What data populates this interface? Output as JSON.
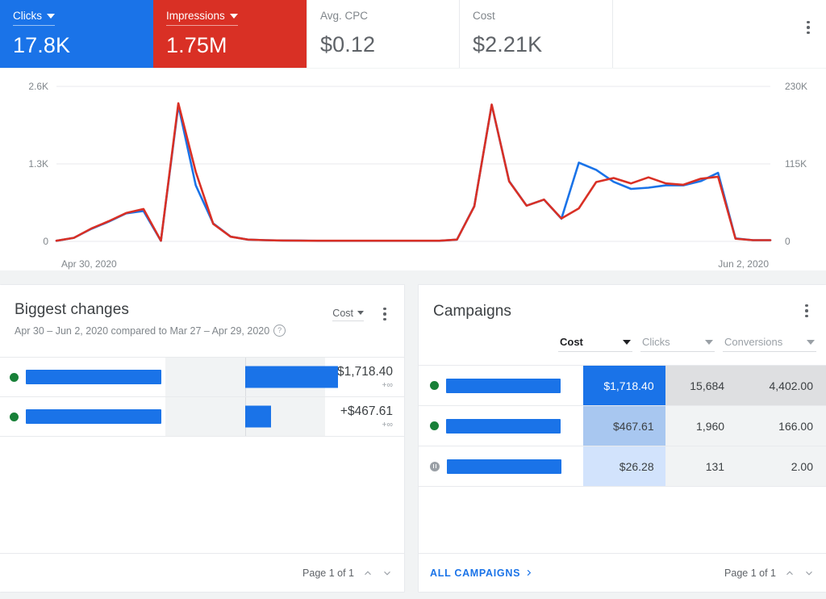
{
  "scorecards": [
    {
      "label": "Clicks",
      "value": "17.8K",
      "style": "blue",
      "icon": "chevron-down-icon"
    },
    {
      "label": "Impressions",
      "value": "1.75M",
      "style": "red",
      "icon": "chevron-down-icon"
    },
    {
      "label": "Avg. CPC",
      "value": "$0.12",
      "style": "plain",
      "icon": ""
    },
    {
      "label": "Cost",
      "value": "$2.21K",
      "style": "plain",
      "icon": ""
    }
  ],
  "strip_menu_icon": "kebab-menu-icon",
  "chart_data": {
    "type": "line",
    "title": "",
    "xlabel": "",
    "ylabel": "Clicks",
    "y2label": "Impressions",
    "grid": true,
    "legend": "none",
    "left_axis": {
      "ticks": [
        "0",
        "1.3K",
        "2.6K"
      ],
      "min": 0,
      "max": 2600
    },
    "right_axis": {
      "ticks": [
        "0",
        "115K",
        "230K"
      ],
      "min": 0,
      "max": 230000
    },
    "x_ticks": [
      "Apr 30, 2020",
      "Jun 2, 2020"
    ],
    "x_start": "Apr 30, 2020",
    "x_end": "Jun 2, 2020",
    "series": [
      {
        "name": "Clicks",
        "color": "#1a73e8",
        "axis": "left",
        "values": [
          10,
          60,
          210,
          330,
          470,
          510,
          10,
          2280,
          940,
          300,
          80,
          30,
          20,
          15,
          12,
          10,
          10,
          10,
          10,
          10,
          10,
          10,
          10,
          30,
          590,
          2290,
          1010,
          600,
          700,
          380,
          1320,
          1200,
          1000,
          880,
          900,
          940,
          940,
          1010,
          1150,
          50,
          20,
          20
        ]
      },
      {
        "name": "Impressions",
        "color": "#d93025",
        "axis": "right",
        "values": [
          900,
          5300,
          19000,
          30000,
          42000,
          48000,
          900,
          205000,
          103000,
          26000,
          7000,
          2600,
          1800,
          1300,
          1100,
          900,
          900,
          900,
          900,
          900,
          900,
          900,
          900,
          2600,
          52000,
          203000,
          89000,
          53000,
          62000,
          34000,
          49000,
          88000,
          94000,
          86000,
          95000,
          86000,
          84000,
          93000,
          96000,
          4000,
          1800,
          1800
        ]
      }
    ]
  },
  "biggest_changes": {
    "title": "Biggest changes",
    "subtitle": "Apr 30 – Jun 2, 2020 compared to Mar 27 – Apr 29, 2020",
    "help_icon": "help-circle-icon",
    "metric_selector": "Cost",
    "metric_caret_icon": "chevron-down-icon",
    "menu_icon": "kebab-menu-icon",
    "rows": [
      {
        "status": "enabled",
        "status_icon": "green-dot-icon",
        "name_redacted": true,
        "name_width": 168,
        "bar_pct": 58,
        "bar_dir": "positive",
        "value": "+$1,718.40",
        "delta": "+∞"
      },
      {
        "status": "enabled",
        "status_icon": "green-dot-icon",
        "name_redacted": true,
        "name_width": 168,
        "bar_pct": 16,
        "bar_dir": "positive",
        "value": "+$467.61",
        "delta": "+∞"
      }
    ],
    "footer": {
      "page_label": "Page 1 of 1",
      "prev_icon": "chevron-up-icon",
      "next_icon": "chevron-down-icon"
    }
  },
  "campaigns": {
    "title": "Campaigns",
    "menu_icon": "kebab-menu-icon",
    "columns": [
      {
        "label": "Cost",
        "active": true,
        "caret_icon": "chevron-down-icon"
      },
      {
        "label": "Clicks",
        "active": false,
        "caret_icon": "chevron-down-icon"
      },
      {
        "label": "Conversions",
        "active": false,
        "caret_icon": "chevron-down-icon"
      }
    ],
    "rows": [
      {
        "status": "enabled",
        "status_icon": "green-dot-icon",
        "name_redacted": true,
        "name_width": 142,
        "cost": "$1,718.40",
        "clicks": "15,684",
        "conversions": "4,402.00",
        "cost_bg": "#1a73e8",
        "cost_fg": "#ffffff",
        "row_bg": "#dedfe1"
      },
      {
        "status": "enabled",
        "status_icon": "green-dot-icon",
        "name_redacted": true,
        "name_width": 142,
        "cost": "$467.61",
        "clicks": "1,960",
        "conversions": "166.00",
        "cost_bg": "#a8c7f0",
        "cost_fg": "#3c4043",
        "row_bg": "#f1f3f4"
      },
      {
        "status": "paused",
        "status_icon": "pause-circle-icon",
        "name_redacted": true,
        "name_width": 142,
        "cost": "$26.28",
        "clicks": "131",
        "conversions": "2.00",
        "cost_bg": "#d2e3fc",
        "cost_fg": "#3c4043",
        "row_bg": "#f1f3f4"
      }
    ],
    "footer": {
      "all_link": "ALL CAMPAIGNS",
      "all_link_icon": "chevron-right-icon",
      "page_label": "Page 1 of 1",
      "prev_icon": "chevron-up-icon",
      "next_icon": "chevron-down-icon"
    }
  },
  "colors": {
    "blue": "#1a73e8",
    "red": "#d93025",
    "green": "#188038",
    "grey": "#9aa0a6"
  }
}
